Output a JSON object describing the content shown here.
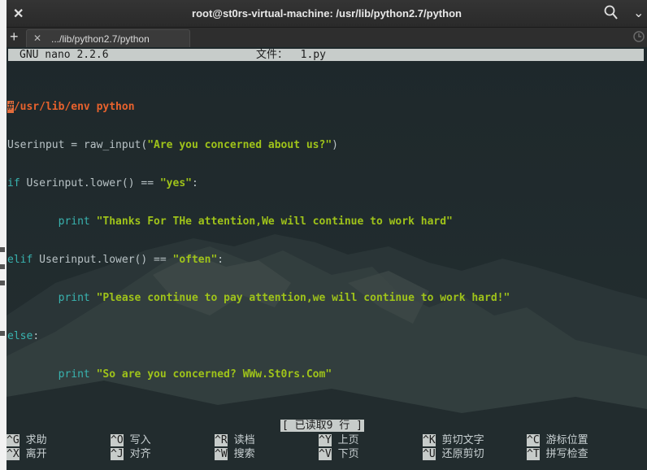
{
  "window": {
    "title": "root@st0rs-virtual-machine: /usr/lib/python2.7/python",
    "close_glyph": "✕",
    "minimize_glyph": "⌄",
    "search_icon": "search-icon"
  },
  "tabbar": {
    "new_tab_glyph": "+",
    "tab_close_glyph": "✕",
    "tab_label": ".../lib/python2.7/python",
    "history_icon": "history-icon"
  },
  "nano": {
    "version": "GNU nano 2.2.6",
    "file_label": "文件：  1.py",
    "status": "[ 已读取9 行 ]"
  },
  "code": {
    "line1_cursor": "#",
    "line1_rest": "/usr/lib/env python",
    "line2_a": "Userinput = raw_input(",
    "line2_b": "\"Are you concerned about us?\"",
    "line2_c": ")",
    "line3_a": "if",
    "line3_b": " Userinput.lower() == ",
    "line3_c": "\"yes\"",
    "line3_d": ":",
    "line4_a": "        print ",
    "line4_b": "\"Thanks For THe attention,We will continue to work hard\"",
    "line5_a": "elif",
    "line5_b": " Userinput.lower() == ",
    "line5_c": "\"often\"",
    "line5_d": ":",
    "line6_a": "        print ",
    "line6_b": "\"Please continue to pay attention,we will continue to work hard!\"",
    "line7_a": "else",
    "line7_b": ":",
    "line8_a": "        print ",
    "line8_b": "\"So are you concerned? WWw.St0rs.Com\""
  },
  "shortcuts": [
    {
      "key": "^G",
      "desc": "求助"
    },
    {
      "key": "^X",
      "desc": "离开"
    },
    {
      "key": "^O",
      "desc": "写入"
    },
    {
      "key": "^J",
      "desc": "对齐"
    },
    {
      "key": "^R",
      "desc": "读档"
    },
    {
      "key": "^W",
      "desc": "搜索"
    },
    {
      "key": "^Y",
      "desc": "上页"
    },
    {
      "key": "^V",
      "desc": "下页"
    },
    {
      "key": "^K",
      "desc": "剪切文字"
    },
    {
      "key": "^U",
      "desc": "还原剪切"
    },
    {
      "key": "^C",
      "desc": "游标位置"
    },
    {
      "key": "^T",
      "desc": "拼写检查"
    }
  ],
  "colors": {
    "terminal_bg": "#1f2a2d",
    "keyword": "#39b4b0",
    "string": "#9fc31a",
    "path": "#e8622d",
    "bar": "#c7ccca"
  }
}
